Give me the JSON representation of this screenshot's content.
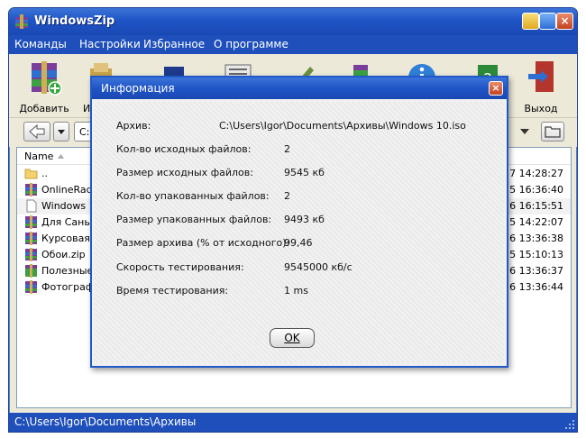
{
  "window": {
    "title": "WindowsZip",
    "close_glyph": "×"
  },
  "menu": [
    "Команды",
    "Настройки",
    "Избранное",
    "О программе"
  ],
  "toolbar": {
    "add_label": "Добавить",
    "extract_label_partial": "И",
    "exit_label": "Выход"
  },
  "address": {
    "value_partial": "C:"
  },
  "filelist": {
    "col_name": "Name",
    "rows": [
      {
        "name": "..",
        "date": "7 14:28:27",
        "icon": "folder-up-icon"
      },
      {
        "name": "OnlineRadio",
        "date": "5 16:36:40",
        "icon": "rar-archive-icon"
      },
      {
        "name": "Windows 10",
        "date": "6 16:15:51",
        "icon": "iso-file-icon"
      },
      {
        "name": "Для Саньк",
        "date": "5 14:22:07",
        "icon": "rar-archive-icon"
      },
      {
        "name": "Курсовая.z",
        "date": "6 13:36:38",
        "icon": "rar-archive-icon"
      },
      {
        "name": "Обои.zip",
        "date": "5 15:10:13",
        "icon": "rar-archive-icon"
      },
      {
        "name": "Полезные п",
        "date": "6 13:36:37",
        "icon": "sfx-archive-icon"
      },
      {
        "name": "Фотографи",
        "date": "6 13:36:44",
        "icon": "rar-archive-icon"
      }
    ]
  },
  "status": {
    "path": "C:\\Users\\Igor\\Documents\\Архивы"
  },
  "dialog": {
    "title": "Информация",
    "close_glyph": "×",
    "fields": [
      {
        "label": "Архив:",
        "value": "C:\\Users\\Igor\\Documents\\Архивы\\Windows 10.iso"
      },
      {
        "label": "Кол-во исходных файлов:",
        "value": "2"
      },
      {
        "label": "Размер исходных файлов:",
        "value": "9545 кб"
      },
      {
        "label": "Кол-во упакованных файлов:",
        "value": "2"
      },
      {
        "label": "Размер упакованных файлов:",
        "value": "9493 кб"
      },
      {
        "label": "Размер архива (% от исходного):",
        "value": "99,46"
      },
      {
        "label": "Скорость тестирования:",
        "value": "9545000 кб/с"
      },
      {
        "label": "Время тестирования:",
        "value": "1 ms"
      }
    ],
    "ok_label": "OK"
  }
}
